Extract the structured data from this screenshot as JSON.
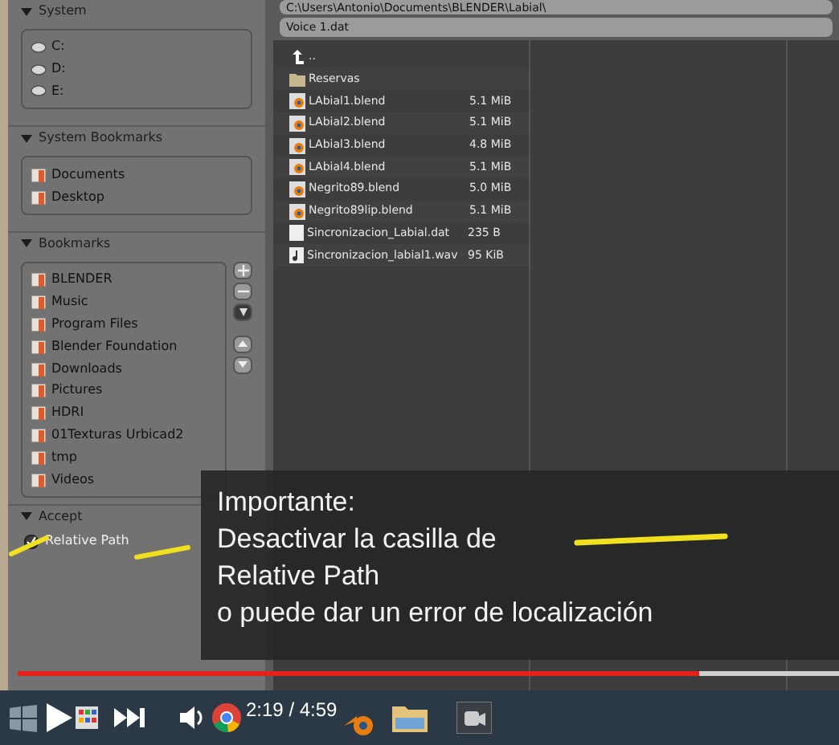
{
  "left_panel": {
    "sections": [
      {
        "title": "System",
        "expanded": true,
        "items": [
          {
            "label": "C:",
            "kind": "drive"
          },
          {
            "label": "D:",
            "kind": "drive"
          },
          {
            "label": "E:",
            "kind": "drive"
          }
        ]
      },
      {
        "title": "System Bookmarks",
        "expanded": true,
        "items": [
          {
            "label": "Documents",
            "kind": "bookmark"
          },
          {
            "label": "Desktop",
            "kind": "bookmark"
          }
        ]
      },
      {
        "title": "Bookmarks",
        "expanded": true,
        "items": [
          {
            "label": "BLENDER",
            "kind": "bookmark"
          },
          {
            "label": "Music",
            "kind": "bookmark"
          },
          {
            "label": "Program Files",
            "kind": "bookmark"
          },
          {
            "label": "Blender Foundation",
            "kind": "bookmark"
          },
          {
            "label": "Downloads",
            "kind": "bookmark"
          },
          {
            "label": "Pictures",
            "kind": "bookmark"
          },
          {
            "label": "HDRI",
            "kind": "bookmark"
          },
          {
            "label": "01Texturas Urbicad2",
            "kind": "bookmark"
          },
          {
            "label": "tmp",
            "kind": "bookmark"
          },
          {
            "label": "Videos",
            "kind": "bookmark"
          }
        ]
      }
    ],
    "accept": {
      "title": "Accept",
      "expanded": true,
      "relative_path": {
        "label": "Relative Path",
        "checked": true
      }
    }
  },
  "path_field": {
    "value": "C:\\Users\\Antonio\\Documents\\BLENDER\\Labial\\"
  },
  "filename_field": {
    "value": "Voice 1.dat"
  },
  "files": [
    {
      "name": "..",
      "kind": "parent"
    },
    {
      "name": "Reservas",
      "kind": "folder"
    },
    {
      "name": "LAbial1.blend",
      "size": "5.1 MiB",
      "kind": "blend"
    },
    {
      "name": "LAbial2.blend",
      "size": "5.1 MiB",
      "kind": "blend"
    },
    {
      "name": "LAbial3.blend",
      "size": "4.8 MiB",
      "kind": "blend"
    },
    {
      "name": "LAbial4.blend",
      "size": "5.1 MiB",
      "kind": "blend"
    },
    {
      "name": "Negrito89.blend",
      "size": "5.0 MiB",
      "kind": "blend"
    },
    {
      "name": "Negrito89lip.blend",
      "size": "5.1 MiB",
      "kind": "blend"
    },
    {
      "name": "Sincronizacion_Labial.dat",
      "size": "235 B",
      "kind": "file"
    },
    {
      "name": "Sincronizacion_labial1.wav",
      "size": "95 KiB",
      "kind": "sound"
    }
  ],
  "caption": [
    "Importante:",
    "Desactivar la casilla de",
    "Relative Path",
    "o puede dar un error de localización"
  ],
  "player": {
    "progress": {
      "level": 0.83
    },
    "time": "2:19 / 4:59"
  }
}
